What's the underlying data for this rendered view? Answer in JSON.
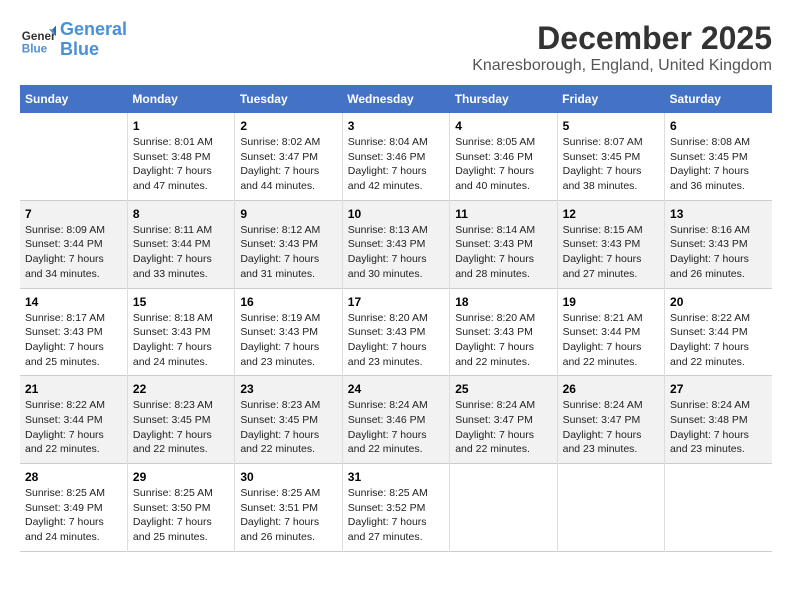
{
  "logo": {
    "line1": "General",
    "line2": "Blue"
  },
  "title": "December 2025",
  "location": "Knaresborough, England, United Kingdom",
  "header_color": "#4472C4",
  "days_of_week": [
    "Sunday",
    "Monday",
    "Tuesday",
    "Wednesday",
    "Thursday",
    "Friday",
    "Saturday"
  ],
  "weeks": [
    [
      {
        "day": null,
        "detail": null
      },
      {
        "day": "1",
        "detail": "Sunrise: 8:01 AM\nSunset: 3:48 PM\nDaylight: 7 hours\nand 47 minutes."
      },
      {
        "day": "2",
        "detail": "Sunrise: 8:02 AM\nSunset: 3:47 PM\nDaylight: 7 hours\nand 44 minutes."
      },
      {
        "day": "3",
        "detail": "Sunrise: 8:04 AM\nSunset: 3:46 PM\nDaylight: 7 hours\nand 42 minutes."
      },
      {
        "day": "4",
        "detail": "Sunrise: 8:05 AM\nSunset: 3:46 PM\nDaylight: 7 hours\nand 40 minutes."
      },
      {
        "day": "5",
        "detail": "Sunrise: 8:07 AM\nSunset: 3:45 PM\nDaylight: 7 hours\nand 38 minutes."
      },
      {
        "day": "6",
        "detail": "Sunrise: 8:08 AM\nSunset: 3:45 PM\nDaylight: 7 hours\nand 36 minutes."
      }
    ],
    [
      {
        "day": "7",
        "detail": "Sunrise: 8:09 AM\nSunset: 3:44 PM\nDaylight: 7 hours\nand 34 minutes."
      },
      {
        "day": "8",
        "detail": "Sunrise: 8:11 AM\nSunset: 3:44 PM\nDaylight: 7 hours\nand 33 minutes."
      },
      {
        "day": "9",
        "detail": "Sunrise: 8:12 AM\nSunset: 3:43 PM\nDaylight: 7 hours\nand 31 minutes."
      },
      {
        "day": "10",
        "detail": "Sunrise: 8:13 AM\nSunset: 3:43 PM\nDaylight: 7 hours\nand 30 minutes."
      },
      {
        "day": "11",
        "detail": "Sunrise: 8:14 AM\nSunset: 3:43 PM\nDaylight: 7 hours\nand 28 minutes."
      },
      {
        "day": "12",
        "detail": "Sunrise: 8:15 AM\nSunset: 3:43 PM\nDaylight: 7 hours\nand 27 minutes."
      },
      {
        "day": "13",
        "detail": "Sunrise: 8:16 AM\nSunset: 3:43 PM\nDaylight: 7 hours\nand 26 minutes."
      }
    ],
    [
      {
        "day": "14",
        "detail": "Sunrise: 8:17 AM\nSunset: 3:43 PM\nDaylight: 7 hours\nand 25 minutes."
      },
      {
        "day": "15",
        "detail": "Sunrise: 8:18 AM\nSunset: 3:43 PM\nDaylight: 7 hours\nand 24 minutes."
      },
      {
        "day": "16",
        "detail": "Sunrise: 8:19 AM\nSunset: 3:43 PM\nDaylight: 7 hours\nand 23 minutes."
      },
      {
        "day": "17",
        "detail": "Sunrise: 8:20 AM\nSunset: 3:43 PM\nDaylight: 7 hours\nand 23 minutes."
      },
      {
        "day": "18",
        "detail": "Sunrise: 8:20 AM\nSunset: 3:43 PM\nDaylight: 7 hours\nand 22 minutes."
      },
      {
        "day": "19",
        "detail": "Sunrise: 8:21 AM\nSunset: 3:44 PM\nDaylight: 7 hours\nand 22 minutes."
      },
      {
        "day": "20",
        "detail": "Sunrise: 8:22 AM\nSunset: 3:44 PM\nDaylight: 7 hours\nand 22 minutes."
      }
    ],
    [
      {
        "day": "21",
        "detail": "Sunrise: 8:22 AM\nSunset: 3:44 PM\nDaylight: 7 hours\nand 22 minutes."
      },
      {
        "day": "22",
        "detail": "Sunrise: 8:23 AM\nSunset: 3:45 PM\nDaylight: 7 hours\nand 22 minutes."
      },
      {
        "day": "23",
        "detail": "Sunrise: 8:23 AM\nSunset: 3:45 PM\nDaylight: 7 hours\nand 22 minutes."
      },
      {
        "day": "24",
        "detail": "Sunrise: 8:24 AM\nSunset: 3:46 PM\nDaylight: 7 hours\nand 22 minutes."
      },
      {
        "day": "25",
        "detail": "Sunrise: 8:24 AM\nSunset: 3:47 PM\nDaylight: 7 hours\nand 22 minutes."
      },
      {
        "day": "26",
        "detail": "Sunrise: 8:24 AM\nSunset: 3:47 PM\nDaylight: 7 hours\nand 23 minutes."
      },
      {
        "day": "27",
        "detail": "Sunrise: 8:24 AM\nSunset: 3:48 PM\nDaylight: 7 hours\nand 23 minutes."
      }
    ],
    [
      {
        "day": "28",
        "detail": "Sunrise: 8:25 AM\nSunset: 3:49 PM\nDaylight: 7 hours\nand 24 minutes."
      },
      {
        "day": "29",
        "detail": "Sunrise: 8:25 AM\nSunset: 3:50 PM\nDaylight: 7 hours\nand 25 minutes."
      },
      {
        "day": "30",
        "detail": "Sunrise: 8:25 AM\nSunset: 3:51 PM\nDaylight: 7 hours\nand 26 minutes."
      },
      {
        "day": "31",
        "detail": "Sunrise: 8:25 AM\nSunset: 3:52 PM\nDaylight: 7 hours\nand 27 minutes."
      },
      {
        "day": null,
        "detail": null
      },
      {
        "day": null,
        "detail": null
      },
      {
        "day": null,
        "detail": null
      }
    ]
  ]
}
